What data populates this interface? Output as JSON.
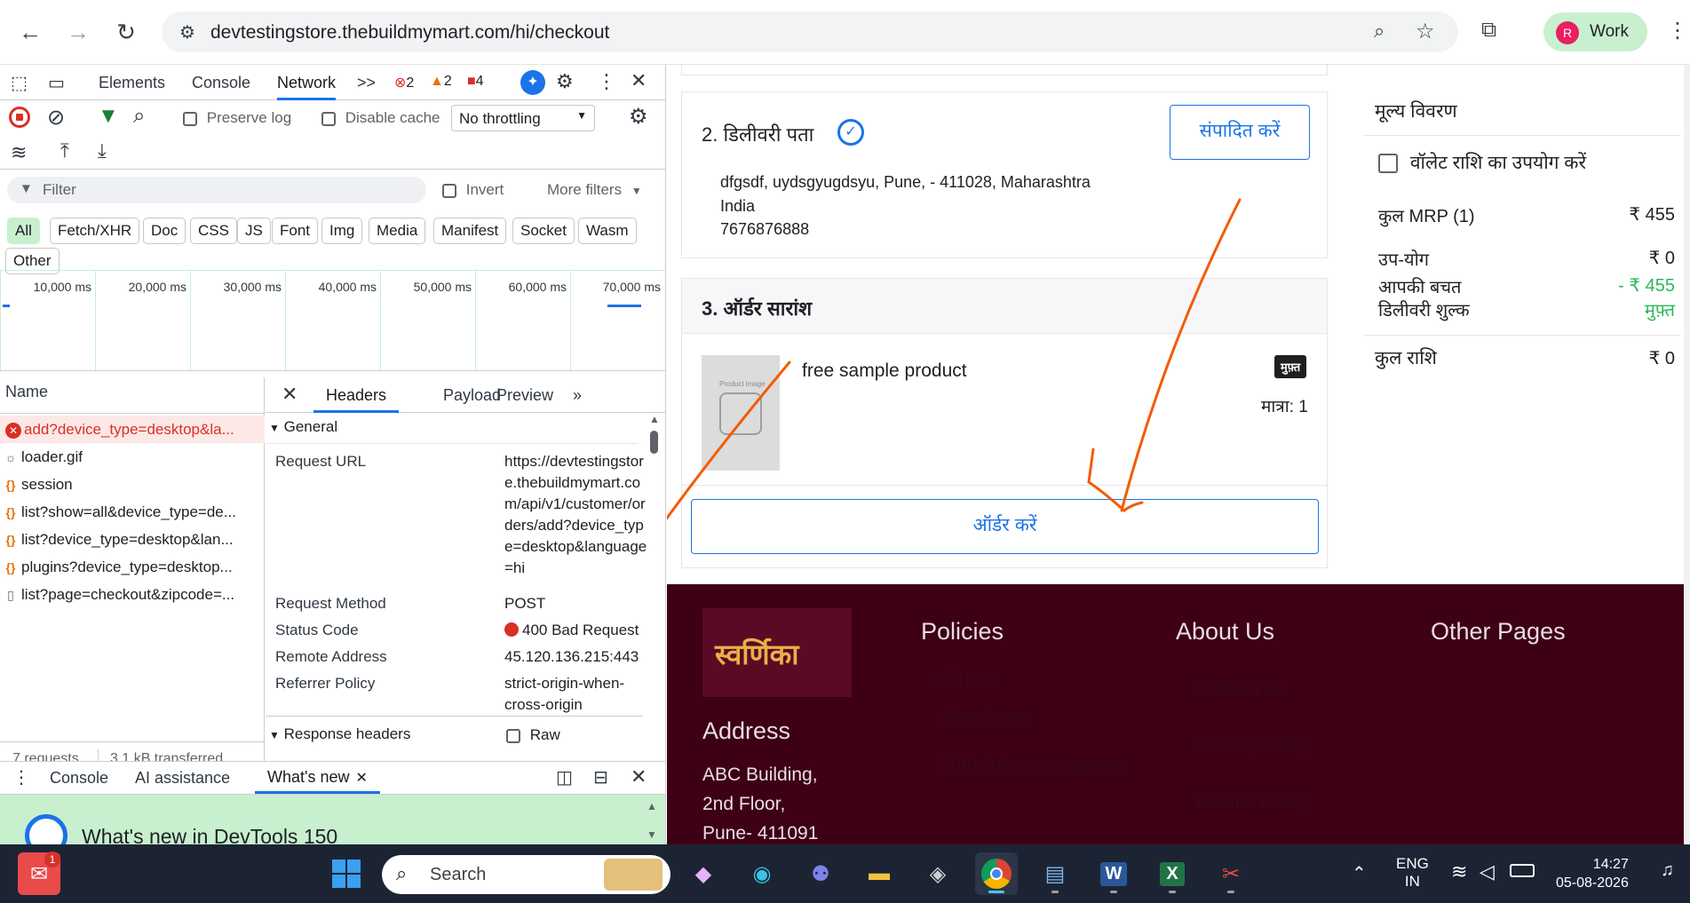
{
  "browser": {
    "url": "devtestingstore.thebuildmymart.com/hi/checkout",
    "profile_initial": "R",
    "profile_label": "Work"
  },
  "devtools": {
    "tabs": [
      "Elements",
      "Console",
      "Network"
    ],
    "more": ">>",
    "errors": "2",
    "warnings": "2",
    "issues": "4",
    "preserve_log": "Preserve log",
    "disable_cache": "Disable cache",
    "throttling": "No throttling",
    "filter_placeholder": "Filter",
    "invert": "Invert",
    "more_filters": "More filters",
    "type_filters": [
      "All",
      "Fetch/XHR",
      "Doc",
      "CSS",
      "JS",
      "Font",
      "Img",
      "Media",
      "Manifest",
      "Socket",
      "Wasm",
      "Other"
    ],
    "timeline_ticks": [
      "10,000 ms",
      "20,000 ms",
      "30,000 ms",
      "40,000 ms",
      "50,000 ms",
      "60,000 ms",
      "70,000 ms"
    ],
    "name_col": "Name",
    "requests": [
      {
        "name": "add?device_type=desktop&la...",
        "icon": "✕",
        "error": true
      },
      {
        "name": "loader.gif",
        "icon": "☼",
        "error": false
      },
      {
        "name": "session",
        "icon": "{}",
        "error": false
      },
      {
        "name": "list?show=all&device_type=de...",
        "icon": "{}",
        "error": false
      },
      {
        "name": "list?device_type=desktop&lan...",
        "icon": "{}",
        "error": false
      },
      {
        "name": "plugins?device_type=desktop...",
        "icon": "{}",
        "error": false
      },
      {
        "name": "list?page=checkout&zipcode=...",
        "icon": "▯",
        "error": false
      }
    ],
    "detail_tabs": [
      "Headers",
      "Payload",
      "Preview"
    ],
    "general": "General",
    "request_url_label": "Request URL",
    "request_url": "https://devtestingstore.thebuildmymart.com/api/v1/customer/orders/add?device_type=desktop&language=hi",
    "request_method_label": "Request Method",
    "request_method": "POST",
    "status_code_label": "Status Code",
    "status_code": "400 Bad Request",
    "remote_address_label": "Remote Address",
    "remote_address": "45.120.136.215:443",
    "referrer_policy_label": "Referrer Policy",
    "referrer_policy": "strict-origin-when-cross-origin",
    "requests_count": "7 requests",
    "transferred": "3.1 kB transferred",
    "response_headers": "Response headers",
    "raw": "Raw",
    "drawer_tabs": [
      "Console",
      "AI assistance",
      "What's new"
    ],
    "whats_new_title": "What's new in DevTools 150"
  },
  "checkout": {
    "delivery_title": "2. डिलीवरी पता",
    "edit_button": "संपादित करें",
    "address_line1": "dfgsdf, uydsgyugdsyu, Pune, - 411028, Maharashtra",
    "address_line2": "India",
    "phone": "7676876888",
    "summary_title": "3. ऑर्डर सारांश",
    "product_name": "free sample product",
    "product_image_text": "Product image",
    "free_badge": "मुफ़्त",
    "quantity": "मात्रा: 1",
    "order_button": "ऑर्डर करें"
  },
  "price": {
    "title": "मूल्य विवरण",
    "wallet": "वॉलेट राशि का उपयोग करें",
    "rows": [
      {
        "label": "कुल MRP (1)",
        "value": "₹ 455"
      },
      {
        "label": "उप-योग",
        "value": "₹ 0"
      },
      {
        "label": "आपकी बचत",
        "value": "- ₹ 455"
      },
      {
        "label": "डिलीवरी शुल्क",
        "value": "मुफ़्त"
      }
    ],
    "total_label": "कुल राशि",
    "total_value": "₹ 0",
    "green": "#2eb85c"
  },
  "footer": {
    "logo": "स्वर्णिका",
    "policies": "Policies",
    "about": "About Us",
    "other": "Other Pages",
    "address_title": "Address",
    "address_lines": [
      "ABC Building,",
      "2nd Floor,",
      "Pune- 411091"
    ],
    "policy_links": [
      "Shirtsss",
      "About usss",
      "10th July cms pagesss"
    ],
    "about_links": [
      "Contact us",
      "Privacy Policy",
      "Refund Policy"
    ]
  },
  "taskbar": {
    "search": "Search",
    "lang1": "ENG",
    "lang2": "IN",
    "time": "14:27",
    "date": "05-08-2026",
    "badge": "1"
  },
  "colors": {
    "accent": "#1a73e8",
    "error": "#d93025",
    "footer_bg": "#3d0014",
    "annotation": "#f25c05"
  }
}
